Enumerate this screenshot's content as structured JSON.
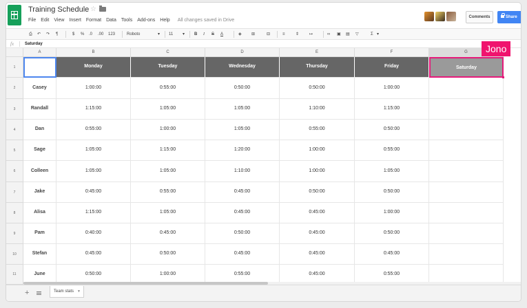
{
  "doc": {
    "title": "Training Schedule",
    "saved_status": "All changes saved in Drive"
  },
  "menu": [
    "File",
    "Edit",
    "View",
    "Insert",
    "Format",
    "Data",
    "Tools",
    "Add-ons",
    "Help"
  ],
  "buttons": {
    "comments": "Comments",
    "share": "Share"
  },
  "toolbar": {
    "number_format": "123",
    "font": "Roboto",
    "font_size": "11",
    "bold": "B",
    "italic": "I",
    "strike": "S",
    "text_color": "A",
    "sum": "Σ"
  },
  "formula_bar": {
    "fx": "fx",
    "value": "Saturday"
  },
  "columns": [
    "A",
    "B",
    "C",
    "D",
    "E",
    "F",
    "G"
  ],
  "rows": [
    "1",
    "2",
    "3",
    "4",
    "5",
    "6",
    "7",
    "8",
    "9",
    "10",
    "11"
  ],
  "table": {
    "header": [
      "",
      "Monday",
      "Tuesday",
      "Wednesday",
      "Thursday",
      "Friday",
      "Saturday"
    ],
    "body": [
      [
        "Casey",
        "1:00:00",
        "0:55:00",
        "0:50:00",
        "0:50:00",
        "1:00:00",
        ""
      ],
      [
        "Randall",
        "1:15:00",
        "1:05:00",
        "1:05:00",
        "1:10:00",
        "1:15:00",
        ""
      ],
      [
        "Dan",
        "0:55:00",
        "1:00:00",
        "1:05:00",
        "0:55:00",
        "0:50:00",
        ""
      ],
      [
        "Sage",
        "1:05:00",
        "1:15:00",
        "1:20:00",
        "1:00:00",
        "0:55:00",
        ""
      ],
      [
        "Colleen",
        "1:05:00",
        "1:05:00",
        "1:10:00",
        "1:00:00",
        "1:05:00",
        ""
      ],
      [
        "Jake",
        "0:45:00",
        "0:55:00",
        "0:45:00",
        "0:50:00",
        "0:50:00",
        ""
      ],
      [
        "Alisa",
        "1:15:00",
        "1:05:00",
        "0:45:00",
        "0:45:00",
        "1:00:00",
        ""
      ],
      [
        "Pam",
        "0:40:00",
        "0:45:00",
        "0:50:00",
        "0:45:00",
        "0:50:00",
        ""
      ],
      [
        "Stefan",
        "0:45:00",
        "0:50:00",
        "0:45:00",
        "0:45:00",
        "0:45:00",
        ""
      ],
      [
        "June",
        "0:50:00",
        "1:00:00",
        "0:55:00",
        "0:45:00",
        "0:55:00",
        ""
      ]
    ]
  },
  "collaborator_label": "Jono",
  "sheet_tabs": [
    "Team stats"
  ],
  "colors": {
    "header_fill": "#666666",
    "selected_header_fill": "#9a9a9a",
    "collaborator": "#f0146e",
    "share": "#4185f4",
    "logo": "#16a05a"
  }
}
